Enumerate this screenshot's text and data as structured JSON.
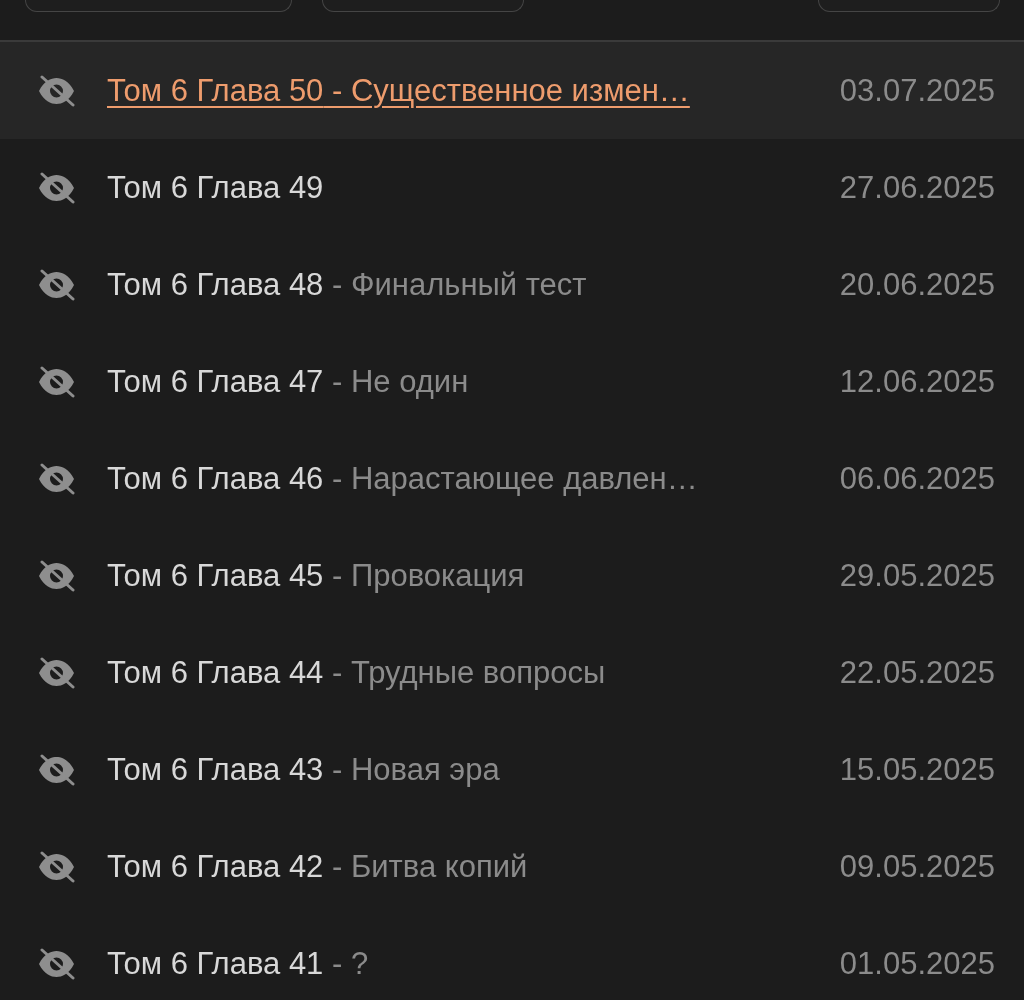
{
  "toolbar": {
    "buttons": [
      {
        "kind": "clipped"
      },
      {
        "kind": "clipped"
      },
      {
        "kind": "clipped"
      }
    ]
  },
  "chapters": [
    {
      "label": "Том 6 Глава 50",
      "subtitle": "- Существенное измен…",
      "date": "03.07.2025",
      "selected": true
    },
    {
      "label": "Том 6 Глава 49",
      "date": "27.06.2025",
      "selected": false
    },
    {
      "label": "Том 6 Глава 48",
      "subtitle": "- Финальный тест",
      "date": "20.06.2025",
      "selected": false
    },
    {
      "label": "Том 6 Глава 47",
      "subtitle": "- Не один",
      "date": "12.06.2025",
      "selected": false
    },
    {
      "label": "Том 6 Глава 46",
      "subtitle": "- Нарастающее давлен…",
      "date": "06.06.2025",
      "selected": false
    },
    {
      "label": "Том 6 Глава 45",
      "subtitle": "- Провокация",
      "date": "29.05.2025",
      "selected": false
    },
    {
      "label": "Том 6 Глава 44",
      "subtitle": "- Трудные вопросы",
      "date": "22.05.2025",
      "selected": false
    },
    {
      "label": "Том 6 Глава 43",
      "subtitle": "- Новая эра",
      "date": "15.05.2025",
      "selected": false
    },
    {
      "label": "Том 6 Глава 42",
      "subtitle": "- Битва копий",
      "date": "09.05.2025",
      "selected": false
    },
    {
      "label": "Том 6 Глава 41",
      "subtitle": "- ?",
      "date": "01.05.2025",
      "selected": false
    }
  ]
}
